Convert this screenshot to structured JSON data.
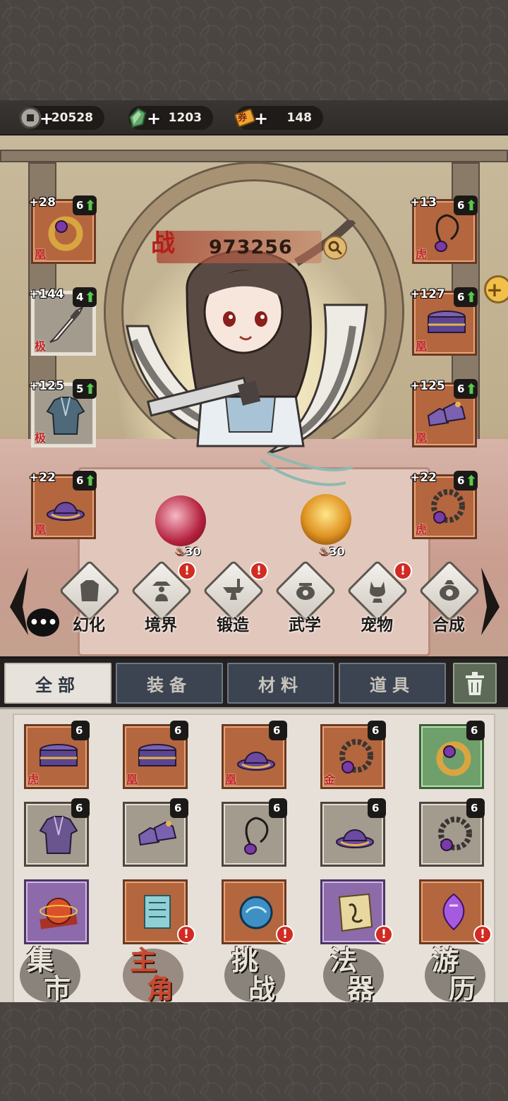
{
  "currency": [
    {
      "icon": "copper-coin-icon",
      "value": "20528"
    },
    {
      "icon": "jade-gem-icon",
      "value": "1203"
    },
    {
      "icon": "ticket-icon",
      "value": "148",
      "icon_text": "券"
    }
  ],
  "power": {
    "label": "战",
    "value": "973256"
  },
  "equipment_left": [
    {
      "level": "+28",
      "count": "6",
      "tier": "凰",
      "icon": "ring-icon",
      "frame": "orange"
    },
    {
      "level": "+144",
      "count": "4",
      "tier": "极",
      "icon": "sword-icon",
      "frame": "gray",
      "selected": true
    },
    {
      "level": "+125",
      "count": "5",
      "tier": "极",
      "icon": "robe-icon",
      "frame": "gray",
      "selected": true
    },
    {
      "level": "+22",
      "count": "6",
      "tier": "凰",
      "icon": "hat-icon",
      "frame": "orange"
    }
  ],
  "equipment_right": [
    {
      "level": "+13",
      "count": "6",
      "tier": "虎",
      "icon": "pendant-icon",
      "frame": "orange"
    },
    {
      "level": "+127",
      "count": "6",
      "tier": "凰",
      "icon": "belt-icon",
      "frame": "orange"
    },
    {
      "level": "+125",
      "count": "6",
      "tier": "凰",
      "icon": "boots-icon",
      "frame": "orange"
    },
    {
      "level": "+22",
      "count": "6",
      "tier": "虎",
      "icon": "bracelet-icon",
      "frame": "orange"
    }
  ],
  "orbs": [
    {
      "icon": "fire-icon",
      "value": "30"
    },
    {
      "icon": "fire-icon",
      "value": "30"
    }
  ],
  "functions": [
    {
      "label": "幻化",
      "icon": "armor-icon",
      "alert": false
    },
    {
      "label": "境界",
      "icon": "meditation-icon",
      "alert": true
    },
    {
      "label": "锻造",
      "icon": "anvil-icon",
      "alert": true
    },
    {
      "label": "武学",
      "icon": "cauldron-icon",
      "alert": false
    },
    {
      "label": "宠物",
      "icon": "cat-icon",
      "alert": true
    },
    {
      "label": "合成",
      "icon": "furnace-icon",
      "alert": false
    }
  ],
  "alert_mark": "!",
  "chat_icon": "•••",
  "tabs": [
    "全部",
    "装备",
    "材料",
    "道具"
  ],
  "active_tab": "全部",
  "inventory": [
    {
      "count": "6",
      "tier": "虎",
      "icon": "belt-icon",
      "frame": "orange"
    },
    {
      "count": "6",
      "tier": "凰",
      "icon": "belt-icon",
      "frame": "orange"
    },
    {
      "count": "6",
      "tier": "凰",
      "icon": "hat-icon",
      "frame": "orange"
    },
    {
      "count": "6",
      "tier": "金",
      "icon": "bracelet-icon",
      "frame": "orange"
    },
    {
      "count": "6",
      "tier": "",
      "icon": "ring-icon",
      "frame": "green"
    },
    {
      "count": "6",
      "tier": "",
      "icon": "robe-icon",
      "frame": "gray"
    },
    {
      "count": "6",
      "tier": "",
      "icon": "boots-icon",
      "frame": "gray"
    },
    {
      "count": "6",
      "tier": "",
      "icon": "pendant-icon",
      "frame": "gray"
    },
    {
      "count": "6",
      "tier": "",
      "icon": "hat-icon",
      "frame": "gray"
    },
    {
      "count": "6",
      "tier": "",
      "icon": "bracelet-icon",
      "frame": "gray"
    },
    {
      "count": "",
      "tier": "",
      "icon": "red-orb-icon",
      "frame": "purple",
      "alert": false
    },
    {
      "count": "",
      "tier": "",
      "icon": "scroll-icon",
      "frame": "orange",
      "alert": true
    },
    {
      "count": "",
      "tier": "",
      "icon": "blue-orb-icon",
      "frame": "orange",
      "alert": true
    },
    {
      "count": "",
      "tier": "",
      "icon": "map-scroll-icon",
      "frame": "purple",
      "alert": true
    },
    {
      "count": "",
      "tier": "",
      "icon": "purple-crystal-icon",
      "frame": "orange",
      "alert": true
    }
  ],
  "nav": [
    {
      "label": [
        "集",
        "市"
      ],
      "active": false
    },
    {
      "label": [
        "主",
        "角"
      ],
      "active": true
    },
    {
      "label": [
        "挑",
        "战"
      ],
      "active": false
    },
    {
      "label": [
        "法",
        "器"
      ],
      "active": false
    },
    {
      "label": [
        "游",
        "历"
      ],
      "active": false
    }
  ],
  "colors": {
    "frame_orange": "#b4663f",
    "frame_gray": "#a39b8e",
    "frame_green": "#6fa06b",
    "frame_purple": "#8d6aa9",
    "tier_red": "#c0231d",
    "upgrade_green": "#58c94c",
    "alert_red": "#d12b22",
    "active_nav": "#c8492f"
  }
}
